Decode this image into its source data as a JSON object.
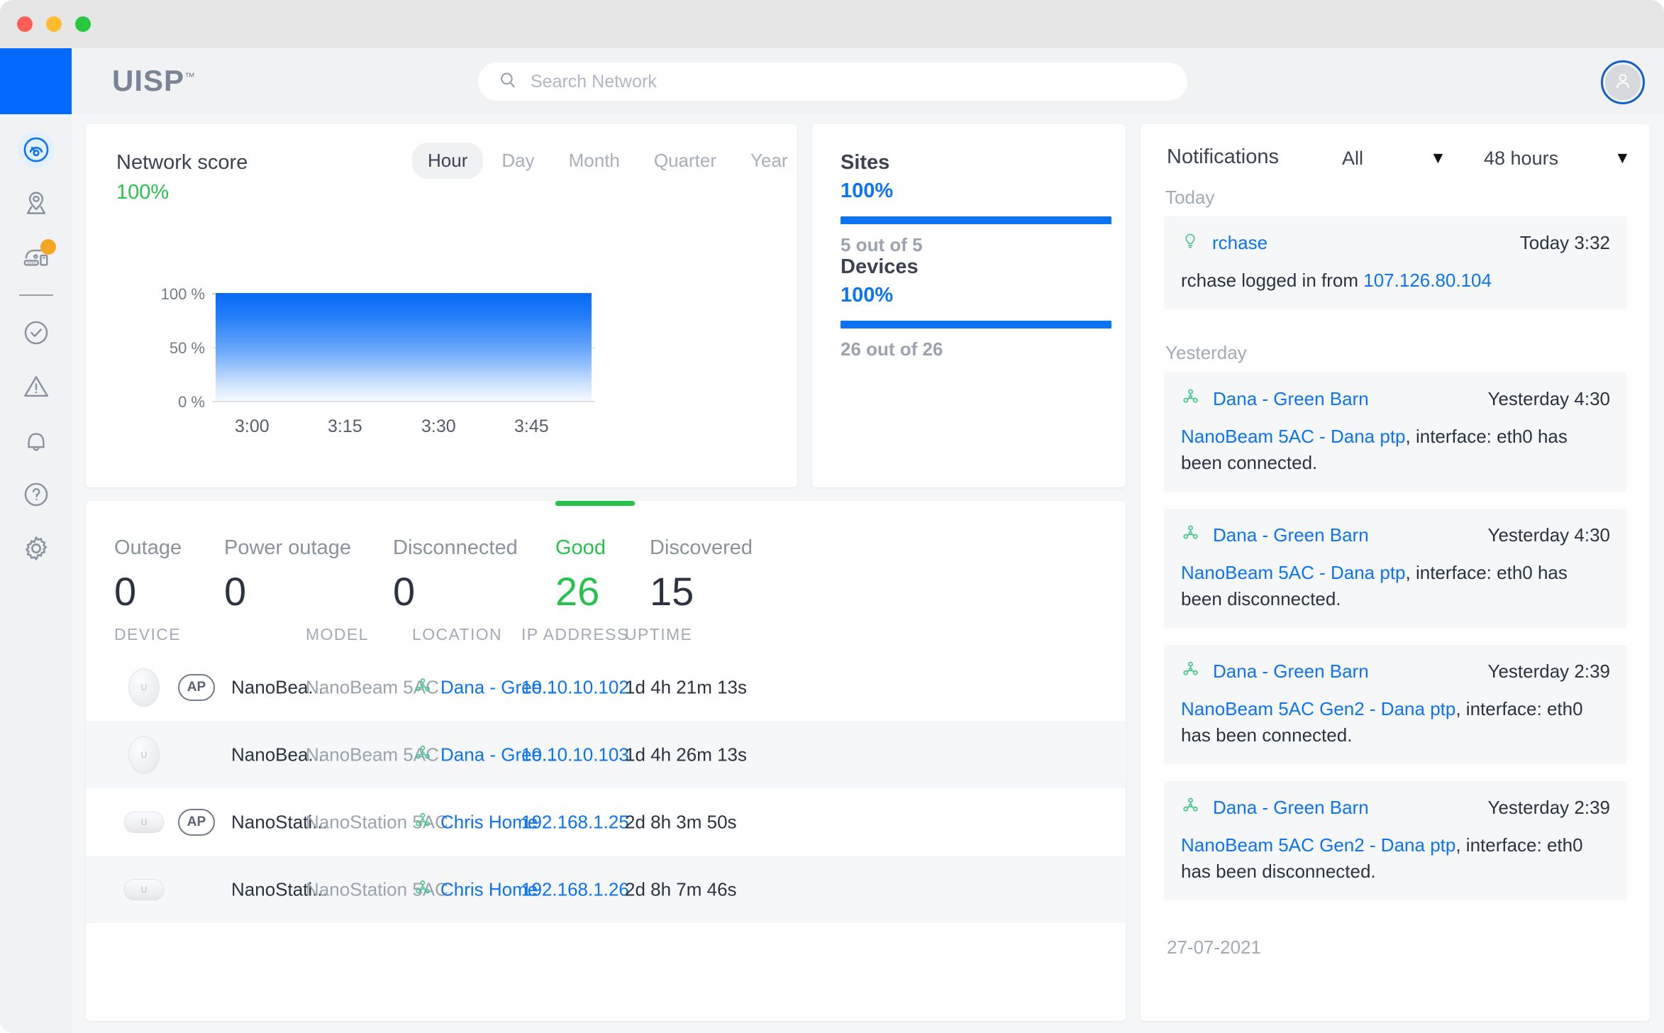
{
  "window": {
    "traffic_lights": [
      "close",
      "minimize",
      "maximize"
    ]
  },
  "header": {
    "brand": "UISP",
    "brand_tm": "™",
    "search": {
      "placeholder": "Search Network",
      "icon": "search-icon"
    },
    "avatar": {
      "icon": "user-avatar-icon"
    }
  },
  "sidebar": {
    "items": [
      {
        "key": "dashboard",
        "icon": "speedometer-icon",
        "active": true,
        "badge": false
      },
      {
        "key": "map",
        "icon": "map-pin-icon",
        "active": false,
        "badge": false
      },
      {
        "key": "devices",
        "icon": "devices-icon",
        "active": false,
        "badge": true
      },
      {
        "key": "divider",
        "icon": "divider",
        "active": false,
        "badge": false
      },
      {
        "key": "health",
        "icon": "check-circle-icon",
        "active": false,
        "badge": false
      },
      {
        "key": "alerts",
        "icon": "warning-triangle-icon",
        "active": false,
        "badge": false
      },
      {
        "key": "notifications",
        "icon": "bell-icon",
        "active": false,
        "badge": false
      },
      {
        "key": "help",
        "icon": "question-circle-icon",
        "active": false,
        "badge": false
      },
      {
        "key": "settings",
        "icon": "gear-icon",
        "active": false,
        "badge": false
      }
    ]
  },
  "network_score": {
    "title": "Network score",
    "value": "100%",
    "ranges": [
      {
        "label": "Hour",
        "active": true
      },
      {
        "label": "Day",
        "active": false
      },
      {
        "label": "Month",
        "active": false
      },
      {
        "label": "Quarter",
        "active": false
      },
      {
        "label": "Year",
        "active": false
      }
    ]
  },
  "chart_data": {
    "type": "area",
    "title": "Network score",
    "xlabel": "",
    "ylabel": "",
    "x": [
      "3:00",
      "3:15",
      "3:30",
      "3:45"
    ],
    "y_ticks": [
      "100 %",
      "50 %",
      "0 %"
    ],
    "ylim": [
      0,
      100
    ],
    "series": [
      {
        "name": "Network score",
        "values": [
          100,
          100,
          100,
          100
        ],
        "color": "#0d73f5"
      }
    ],
    "grid": true,
    "legend": "none"
  },
  "summary": {
    "sites": {
      "label": "Sites",
      "percent": "100%",
      "percent_value": 100,
      "sub": "5  out of 5"
    },
    "devices": {
      "label": "Devices",
      "percent": "100%",
      "percent_value": 100,
      "sub": "26 out of 26"
    },
    "bar_color": "#0d73f5"
  },
  "status_tabs": [
    {
      "label": "Outage",
      "count": "0",
      "active": false
    },
    {
      "label": "Power outage",
      "count": "0",
      "active": false
    },
    {
      "label": "Disconnected",
      "count": "0",
      "active": false
    },
    {
      "label": "Good",
      "count": "26",
      "active": true
    },
    {
      "label": "Discovered",
      "count": "15",
      "active": false
    }
  ],
  "device_table": {
    "columns": [
      "DEVICE",
      "MODEL",
      "LOCATION",
      "IP ADDRESS",
      "UPTIME"
    ],
    "rows": [
      {
        "device_icon": "nanobeam-dish-icon",
        "ap_badge": "AP",
        "has_ap": true,
        "name": "NanoBea...",
        "model": "NanoBeam 5AC",
        "location": "Dana - Gree...",
        "location_icon": "site-topology-icon",
        "ip": "10.10.10.102",
        "uptime": "1d 4h 21m 13s"
      },
      {
        "device_icon": "nanobeam-dish-icon",
        "ap_badge": "",
        "has_ap": false,
        "name": "NanoBea...",
        "model": "NanoBeam 5AC",
        "location": "Dana - Gree...",
        "location_icon": "site-topology-icon",
        "ip": "10.10.10.103",
        "uptime": "1d 4h 26m 13s"
      },
      {
        "device_icon": "nanostation-icon",
        "ap_badge": "AP",
        "has_ap": true,
        "name": "NanoStati...",
        "model": "NanoStation 5AC...",
        "location": "Chris Home",
        "location_icon": "site-topology-icon",
        "ip": "192.168.1.25",
        "uptime": "2d 8h 3m 50s"
      },
      {
        "device_icon": "nanostation-icon",
        "ap_badge": "",
        "has_ap": false,
        "name": "NanoStati...",
        "model": "NanoStation 5AC...",
        "location": "Chris Home",
        "location_icon": "site-topology-icon",
        "ip": "192.168.1.26",
        "uptime": "2d 8h 7m 46s"
      }
    ]
  },
  "notifications": {
    "title": "Notifications",
    "filter_type": "All",
    "filter_time": "48 hours",
    "caret": "▼",
    "groups": [
      {
        "heading": "Today"
      },
      {
        "heading": "Yesterday"
      }
    ],
    "date_footer": "27-07-2021",
    "items": [
      {
        "group": "Today",
        "icon": "lightbulb-icon",
        "icon_color": "#3ec98a",
        "source": "rchase",
        "time": "Today 3:32",
        "body_prefix": "rchase logged in from ",
        "body_link": "107.126.80.104",
        "body_suffix": ""
      },
      {
        "group": "Yesterday",
        "icon": "site-topology-icon",
        "icon_color": "#3ec98a",
        "source": "Dana - Green Barn",
        "time": "Yesterday 4:30",
        "body_prefix": "",
        "body_link": "NanoBeam 5AC - Dana ptp",
        "body_suffix": ", interface: eth0 has been connected."
      },
      {
        "group": "Yesterday",
        "icon": "site-topology-icon",
        "icon_color": "#3ec98a",
        "source": "Dana - Green Barn",
        "time": "Yesterday 4:30",
        "body_prefix": "",
        "body_link": "NanoBeam 5AC - Dana ptp",
        "body_suffix": ", interface: eth0 has been disconnected."
      },
      {
        "group": "Yesterday",
        "icon": "site-topology-icon",
        "icon_color": "#3ec98a",
        "source": "Dana - Green Barn",
        "time": "Yesterday 2:39",
        "body_prefix": "",
        "body_link": "NanoBeam 5AC Gen2 - Dana ptp",
        "body_suffix": ", interface: eth0 has been connected."
      },
      {
        "group": "Yesterday",
        "icon": "site-topology-icon",
        "icon_color": "#3ec98a",
        "source": "Dana - Green Barn",
        "time": "Yesterday 2:39",
        "body_prefix": "",
        "body_link": "NanoBeam 5AC Gen2 - Dana ptp",
        "body_suffix": ", interface: eth0 has been disconnected."
      }
    ]
  },
  "colors": {
    "accent_blue": "#0d73f5",
    "brand_blue": "#0469ff",
    "good_green": "#27c24c",
    "site_green": "#3ec98a",
    "badge_orange": "#f5a623"
  }
}
